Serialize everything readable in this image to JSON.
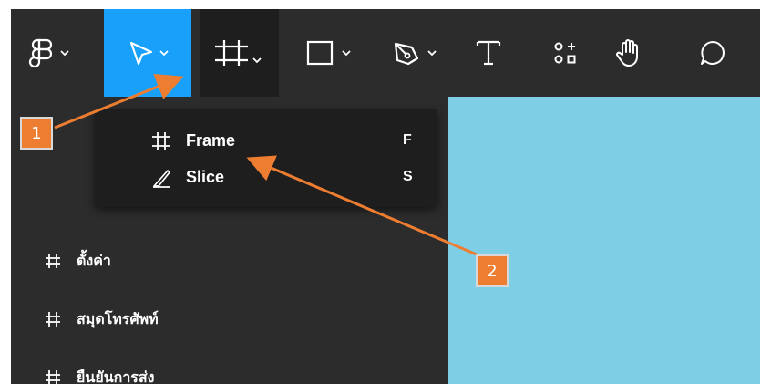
{
  "toolbar": {
    "tools": [
      {
        "name": "main-menu",
        "icon": "figma-logo-icon"
      },
      {
        "name": "move",
        "icon": "move-cursor-icon",
        "active": true
      },
      {
        "name": "frame",
        "icon": "frame-hash-icon",
        "open": true
      },
      {
        "name": "shape",
        "icon": "rectangle-icon"
      },
      {
        "name": "pen",
        "icon": "pen-icon"
      },
      {
        "name": "text",
        "icon": "text-icon",
        "label": "T"
      },
      {
        "name": "resources",
        "icon": "resources-icon"
      },
      {
        "name": "hand",
        "icon": "hand-icon"
      },
      {
        "name": "comment",
        "icon": "comment-icon"
      }
    ]
  },
  "dropdown": {
    "items": [
      {
        "label": "Frame",
        "shortcut": "F",
        "icon": "frame-hash-icon"
      },
      {
        "label": "Slice",
        "shortcut": "S",
        "icon": "slice-knife-icon"
      }
    ]
  },
  "layers": {
    "items": [
      {
        "label": "ตั้งค่า",
        "icon": "frame-hash-icon"
      },
      {
        "label": "สมุดโทรศัพท์",
        "icon": "frame-hash-icon"
      },
      {
        "label": "ยืนยันการส่ง",
        "icon": "frame-hash-icon"
      }
    ]
  },
  "annotations": {
    "badge_1": "1",
    "badge_2": "2"
  },
  "colors": {
    "toolbar_bg": "#2c2c2c",
    "active_tool": "#18a0fb",
    "dropdown_bg": "#1e1e1e",
    "canvas": "#7ecfe6",
    "annotation": "#ed7d31"
  }
}
